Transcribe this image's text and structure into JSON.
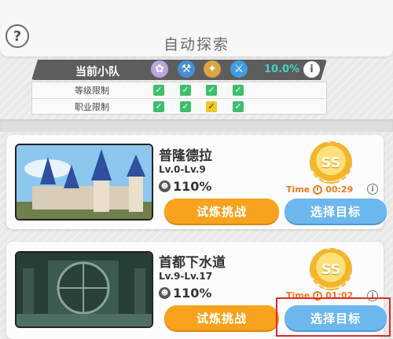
{
  "header": {
    "help_icon": "?",
    "title": "自动探索"
  },
  "team": {
    "label": "当前小队",
    "icons": [
      "character-1-icon",
      "character-2-icon",
      "character-3-icon",
      "character-4-icon"
    ],
    "rate": "10.0%",
    "info_icon": "i"
  },
  "restrictions": {
    "rows": [
      {
        "label": "等级限制",
        "checks": [
          "ok",
          "ok",
          "ok",
          "ok"
        ]
      },
      {
        "label": "职业限制",
        "checks": [
          "ok",
          "ok",
          "warn",
          "ok"
        ]
      }
    ],
    "ok_symbol": "✓",
    "colors": {
      "ok": "#3fbe6a",
      "warn": "#f2c526"
    }
  },
  "cards": [
    {
      "name": "普隆德拉",
      "level": "Lv.0-Lv.9",
      "rate": "110%",
      "badge": "SS",
      "time_label": "Time",
      "time": "00:29",
      "challenge_label": "试炼挑战",
      "select_label": "选择目标"
    },
    {
      "name": "首都下水道",
      "level": "Lv.9-Lv.17",
      "rate": "110%",
      "badge": "SS",
      "time_label": "Time",
      "time": "01:02",
      "challenge_label": "试炼挑战",
      "select_label": "选择目标"
    }
  ],
  "colors": {
    "orange_button": "#f8a21e",
    "blue_button": "#6db7ef",
    "highlight": "#e0282a",
    "teal_rate": "#46d0c0"
  }
}
